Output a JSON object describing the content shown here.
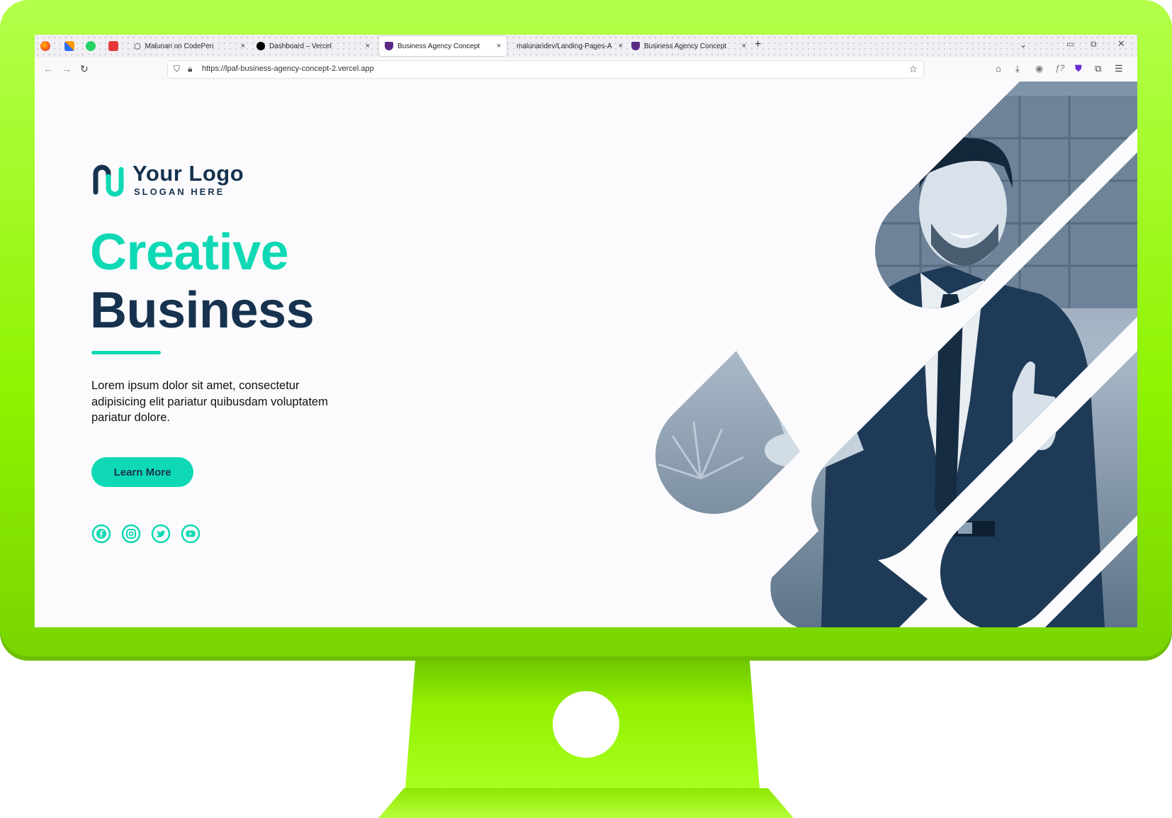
{
  "browser": {
    "tabs": [
      {
        "label": "Malunari on CodePen",
        "icon": "codepen-icon"
      },
      {
        "label": "Dashboard – Vercel",
        "icon": "vercel-icon"
      },
      {
        "label": "Business Agency Concept",
        "icon": "shield-favicon-icon",
        "active": true
      },
      {
        "label": "malunaridev/Landing-Pages-A",
        "icon": "github-icon"
      },
      {
        "label": "Business Agency Concept",
        "icon": "shield-favicon-icon"
      }
    ],
    "close_glyph": "×",
    "new_tab_glyph": "+",
    "url": "https://lpaf-business-agency-concept-2.vercel.app"
  },
  "site": {
    "logo": {
      "title": "Your Logo",
      "slogan": "SLOGAN HERE"
    },
    "headline_line1": "Creative",
    "headline_line2": "Business",
    "description": "Lorem ipsum dolor sit amet, consectetur adipisicing elit pariatur quibusdam voluptatem pariatur dolore.",
    "cta_label": "Learn More",
    "social": [
      "facebook-icon",
      "instagram-icon",
      "twitter-icon",
      "youtube-icon"
    ]
  },
  "colors": {
    "accent": "#0fd9b4",
    "dark": "#16324f",
    "monitor": "#8ef300"
  }
}
